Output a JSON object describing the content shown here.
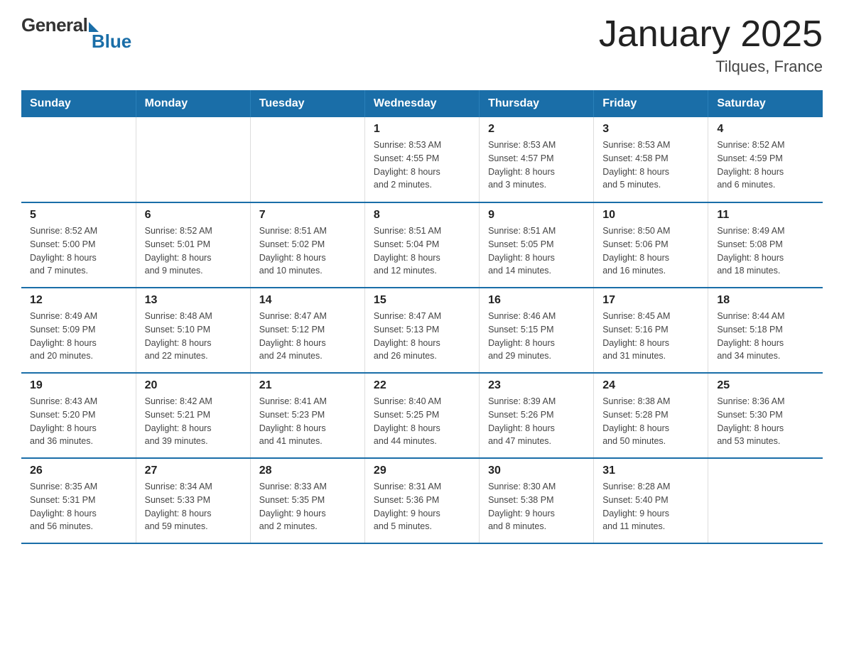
{
  "logo": {
    "general": "General",
    "blue": "Blue"
  },
  "header": {
    "title": "January 2025",
    "location": "Tilques, France"
  },
  "days_of_week": [
    "Sunday",
    "Monday",
    "Tuesday",
    "Wednesday",
    "Thursday",
    "Friday",
    "Saturday"
  ],
  "weeks": [
    [
      {
        "day": "",
        "info": ""
      },
      {
        "day": "",
        "info": ""
      },
      {
        "day": "",
        "info": ""
      },
      {
        "day": "1",
        "info": "Sunrise: 8:53 AM\nSunset: 4:55 PM\nDaylight: 8 hours\nand 2 minutes."
      },
      {
        "day": "2",
        "info": "Sunrise: 8:53 AM\nSunset: 4:57 PM\nDaylight: 8 hours\nand 3 minutes."
      },
      {
        "day": "3",
        "info": "Sunrise: 8:53 AM\nSunset: 4:58 PM\nDaylight: 8 hours\nand 5 minutes."
      },
      {
        "day": "4",
        "info": "Sunrise: 8:52 AM\nSunset: 4:59 PM\nDaylight: 8 hours\nand 6 minutes."
      }
    ],
    [
      {
        "day": "5",
        "info": "Sunrise: 8:52 AM\nSunset: 5:00 PM\nDaylight: 8 hours\nand 7 minutes."
      },
      {
        "day": "6",
        "info": "Sunrise: 8:52 AM\nSunset: 5:01 PM\nDaylight: 8 hours\nand 9 minutes."
      },
      {
        "day": "7",
        "info": "Sunrise: 8:51 AM\nSunset: 5:02 PM\nDaylight: 8 hours\nand 10 minutes."
      },
      {
        "day": "8",
        "info": "Sunrise: 8:51 AM\nSunset: 5:04 PM\nDaylight: 8 hours\nand 12 minutes."
      },
      {
        "day": "9",
        "info": "Sunrise: 8:51 AM\nSunset: 5:05 PM\nDaylight: 8 hours\nand 14 minutes."
      },
      {
        "day": "10",
        "info": "Sunrise: 8:50 AM\nSunset: 5:06 PM\nDaylight: 8 hours\nand 16 minutes."
      },
      {
        "day": "11",
        "info": "Sunrise: 8:49 AM\nSunset: 5:08 PM\nDaylight: 8 hours\nand 18 minutes."
      }
    ],
    [
      {
        "day": "12",
        "info": "Sunrise: 8:49 AM\nSunset: 5:09 PM\nDaylight: 8 hours\nand 20 minutes."
      },
      {
        "day": "13",
        "info": "Sunrise: 8:48 AM\nSunset: 5:10 PM\nDaylight: 8 hours\nand 22 minutes."
      },
      {
        "day": "14",
        "info": "Sunrise: 8:47 AM\nSunset: 5:12 PM\nDaylight: 8 hours\nand 24 minutes."
      },
      {
        "day": "15",
        "info": "Sunrise: 8:47 AM\nSunset: 5:13 PM\nDaylight: 8 hours\nand 26 minutes."
      },
      {
        "day": "16",
        "info": "Sunrise: 8:46 AM\nSunset: 5:15 PM\nDaylight: 8 hours\nand 29 minutes."
      },
      {
        "day": "17",
        "info": "Sunrise: 8:45 AM\nSunset: 5:16 PM\nDaylight: 8 hours\nand 31 minutes."
      },
      {
        "day": "18",
        "info": "Sunrise: 8:44 AM\nSunset: 5:18 PM\nDaylight: 8 hours\nand 34 minutes."
      }
    ],
    [
      {
        "day": "19",
        "info": "Sunrise: 8:43 AM\nSunset: 5:20 PM\nDaylight: 8 hours\nand 36 minutes."
      },
      {
        "day": "20",
        "info": "Sunrise: 8:42 AM\nSunset: 5:21 PM\nDaylight: 8 hours\nand 39 minutes."
      },
      {
        "day": "21",
        "info": "Sunrise: 8:41 AM\nSunset: 5:23 PM\nDaylight: 8 hours\nand 41 minutes."
      },
      {
        "day": "22",
        "info": "Sunrise: 8:40 AM\nSunset: 5:25 PM\nDaylight: 8 hours\nand 44 minutes."
      },
      {
        "day": "23",
        "info": "Sunrise: 8:39 AM\nSunset: 5:26 PM\nDaylight: 8 hours\nand 47 minutes."
      },
      {
        "day": "24",
        "info": "Sunrise: 8:38 AM\nSunset: 5:28 PM\nDaylight: 8 hours\nand 50 minutes."
      },
      {
        "day": "25",
        "info": "Sunrise: 8:36 AM\nSunset: 5:30 PM\nDaylight: 8 hours\nand 53 minutes."
      }
    ],
    [
      {
        "day": "26",
        "info": "Sunrise: 8:35 AM\nSunset: 5:31 PM\nDaylight: 8 hours\nand 56 minutes."
      },
      {
        "day": "27",
        "info": "Sunrise: 8:34 AM\nSunset: 5:33 PM\nDaylight: 8 hours\nand 59 minutes."
      },
      {
        "day": "28",
        "info": "Sunrise: 8:33 AM\nSunset: 5:35 PM\nDaylight: 9 hours\nand 2 minutes."
      },
      {
        "day": "29",
        "info": "Sunrise: 8:31 AM\nSunset: 5:36 PM\nDaylight: 9 hours\nand 5 minutes."
      },
      {
        "day": "30",
        "info": "Sunrise: 8:30 AM\nSunset: 5:38 PM\nDaylight: 9 hours\nand 8 minutes."
      },
      {
        "day": "31",
        "info": "Sunrise: 8:28 AM\nSunset: 5:40 PM\nDaylight: 9 hours\nand 11 minutes."
      },
      {
        "day": "",
        "info": ""
      }
    ]
  ]
}
